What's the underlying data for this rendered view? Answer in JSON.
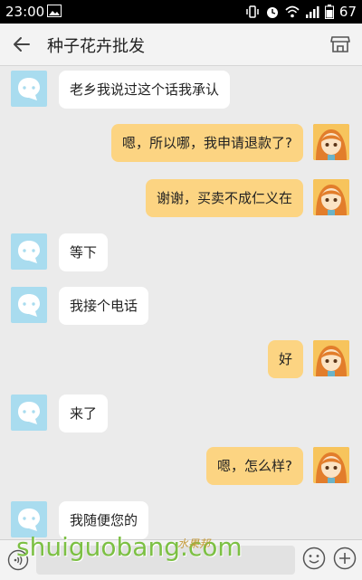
{
  "status_bar": {
    "time": "23:00",
    "battery": "67",
    "icons": [
      "image-icon",
      "vibrate-icon",
      "alarm-icon",
      "wifi-icon",
      "signal-icon",
      "battery-icon"
    ]
  },
  "app_bar": {
    "title": "种子花卉批发",
    "back_icon": "back-arrow-icon",
    "shop_icon": "shop-icon"
  },
  "messages": [
    {
      "side": "in",
      "text": "老乡我说过这个话我承认"
    },
    {
      "side": "out",
      "text": "嗯，所以哪，我申请退款了?"
    },
    {
      "side": "out",
      "text": "谢谢，买卖不成仁义在"
    },
    {
      "side": "in",
      "text": "等下"
    },
    {
      "side": "in",
      "text": "我接个电话"
    },
    {
      "side": "out",
      "text": "好"
    },
    {
      "side": "in",
      "text": "来了"
    },
    {
      "side": "out",
      "text": "嗯，怎么样?"
    },
    {
      "side": "in",
      "text": "我随便您的"
    }
  ],
  "input_bar": {
    "voice_icon": "voice-icon",
    "emoji_icon": "emoji-icon",
    "plus_icon": "plus-icon"
  },
  "watermark": {
    "text": "shuiguobang.com",
    "text_cn": "水果邦"
  },
  "colors": {
    "incoming_bubble": "#ffffff",
    "outgoing_bubble": "#fcd482",
    "bot_avatar": "#a9dcef",
    "background": "#ebebeb"
  }
}
